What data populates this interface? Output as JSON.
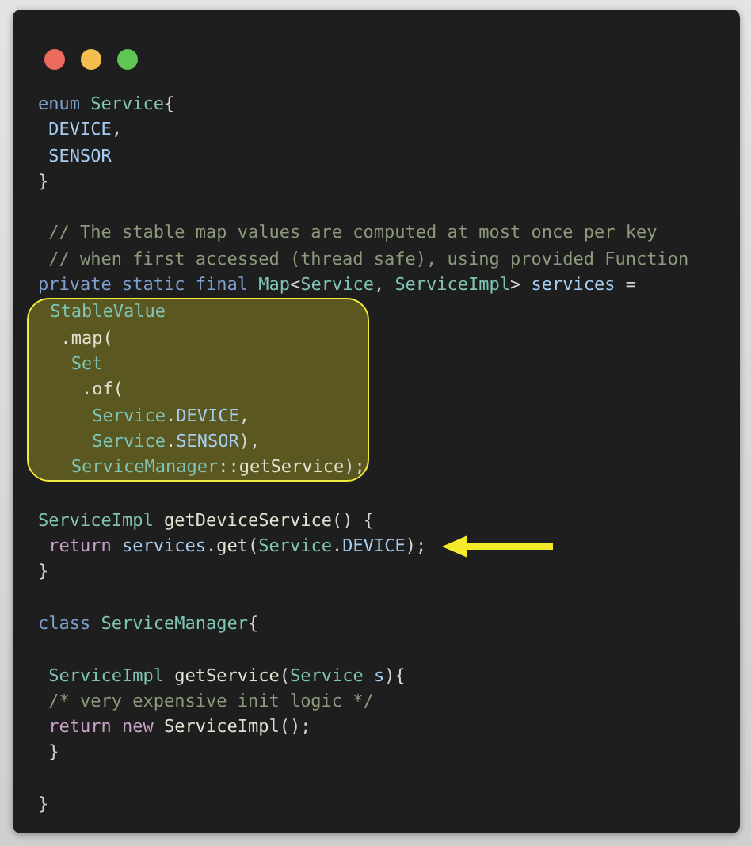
{
  "window": {
    "controls": [
      {
        "color": "#ec6a5e"
      },
      {
        "color": "#f4bf4f"
      },
      {
        "color": "#61c554"
      }
    ]
  },
  "code": {
    "blocks": [
      {
        "kind": "plain",
        "lines": [
          {
            "kind": "code",
            "tokens": [
              {
                "t": "enum ",
                "color": "#7f9fcf"
              },
              {
                "t": "Service",
                "color": "#7fc4b4"
              },
              {
                "t": "{",
                "color": "#d4d4d4"
              }
            ]
          },
          {
            "kind": "code",
            "tokens": [
              {
                "t": " DEVICE",
                "color": "#a6cdf2"
              },
              {
                "t": ",",
                "color": "#d4d4d4"
              }
            ]
          },
          {
            "kind": "code",
            "tokens": [
              {
                "t": " SENSOR",
                "color": "#a6cdf2"
              }
            ]
          },
          {
            "kind": "code",
            "tokens": [
              {
                "t": "}",
                "color": "#d4d4d4"
              }
            ]
          },
          {
            "kind": "blank"
          },
          {
            "kind": "code",
            "tokens": [
              {
                "t": " // The stable map values are computed at most once per key",
                "color": "#8d9a7c"
              }
            ]
          },
          {
            "kind": "code",
            "tokens": [
              {
                "t": " // when first accessed (thread safe), using provided Function",
                "color": "#8d9a7c"
              }
            ]
          },
          {
            "kind": "code",
            "tokens": [
              {
                "t": "private static final ",
                "color": "#7f9fcf"
              },
              {
                "t": "Map",
                "color": "#7fc4b4"
              },
              {
                "t": "<",
                "color": "#d4d4d4"
              },
              {
                "t": "Service",
                "color": "#7fc4b4"
              },
              {
                "t": ", ",
                "color": "#d4d4d4"
              },
              {
                "t": "ServiceImpl",
                "color": "#7fc4b4"
              },
              {
                "t": "> ",
                "color": "#d4d4d4"
              },
              {
                "t": "services",
                "color": "#a6cdf2"
              },
              {
                "t": " =",
                "color": "#d4d4d4"
              }
            ]
          }
        ]
      },
      {
        "kind": "highlight",
        "lines": [
          {
            "kind": "code",
            "tokens": [
              {
                "t": " StableValue",
                "color": "#7fc4b4"
              }
            ]
          },
          {
            "kind": "code",
            "tokens": [
              {
                "t": "  .map(",
                "color": "#e2e2d2"
              }
            ]
          },
          {
            "kind": "code",
            "tokens": [
              {
                "t": "   Set",
                "color": "#7fc4b4"
              }
            ]
          },
          {
            "kind": "code",
            "tokens": [
              {
                "t": "    .of(",
                "color": "#e2e2d2"
              }
            ]
          },
          {
            "kind": "code",
            "tokens": [
              {
                "t": "     Service",
                "color": "#7fc4b4"
              },
              {
                "t": ".",
                "color": "#d4d4d4"
              },
              {
                "t": "DEVICE",
                "color": "#a6cdf2"
              },
              {
                "t": ",",
                "color": "#d4d4d4"
              }
            ]
          },
          {
            "kind": "code",
            "tokens": [
              {
                "t": "     Service",
                "color": "#7fc4b4"
              },
              {
                "t": ".",
                "color": "#d4d4d4"
              },
              {
                "t": "SENSOR",
                "color": "#a6cdf2"
              },
              {
                "t": "),",
                "color": "#d4d4d4"
              }
            ]
          },
          {
            "kind": "code",
            "tokens": [
              {
                "t": "   ServiceManager",
                "color": "#7fc4b4"
              },
              {
                "t": "::",
                "color": "#d4d4d4"
              },
              {
                "t": "getService",
                "color": "#e2e2d2"
              },
              {
                "t": ");",
                "color": "#d4d4d4"
              }
            ]
          }
        ]
      },
      {
        "kind": "plain",
        "lines": [
          {
            "kind": "blank"
          },
          {
            "kind": "code",
            "tokens": [
              {
                "t": "ServiceImpl ",
                "color": "#7fc4b4"
              },
              {
                "t": "getDeviceService",
                "color": "#e2e2d2"
              },
              {
                "t": "() {",
                "color": "#d4d4d4"
              }
            ]
          },
          {
            "kind": "pointed",
            "tokens": [
              {
                "t": " return ",
                "color": "#c6a0c6"
              },
              {
                "t": "services",
                "color": "#a6cdf2"
              },
              {
                "t": ".",
                "color": "#d4d4d4"
              },
              {
                "t": "get",
                "color": "#e2e2d2"
              },
              {
                "t": "(",
                "color": "#d4d4d4"
              },
              {
                "t": "Service",
                "color": "#7fc4b4"
              },
              {
                "t": ".",
                "color": "#d4d4d4"
              },
              {
                "t": "DEVICE",
                "color": "#a6cdf2"
              },
              {
                "t": ");",
                "color": "#d4d4d4"
              }
            ]
          },
          {
            "kind": "code",
            "tokens": [
              {
                "t": "}",
                "color": "#d4d4d4"
              }
            ]
          },
          {
            "kind": "blank"
          },
          {
            "kind": "code",
            "tokens": [
              {
                "t": "class ",
                "color": "#7f9fcf"
              },
              {
                "t": "ServiceManager",
                "color": "#7fc4b4"
              },
              {
                "t": "{",
                "color": "#d4d4d4"
              }
            ]
          },
          {
            "kind": "blank"
          },
          {
            "kind": "code",
            "tokens": [
              {
                "t": " ServiceImpl ",
                "color": "#7fc4b4"
              },
              {
                "t": "getService",
                "color": "#e2e2d2"
              },
              {
                "t": "(",
                "color": "#d4d4d4"
              },
              {
                "t": "Service ",
                "color": "#7fc4b4"
              },
              {
                "t": "s",
                "color": "#a6cdf2"
              },
              {
                "t": "){",
                "color": "#d4d4d4"
              }
            ]
          },
          {
            "kind": "code",
            "tokens": [
              {
                "t": " /* very expensive init logic */",
                "color": "#8d9a7c"
              }
            ]
          },
          {
            "kind": "code",
            "tokens": [
              {
                "t": " return new ",
                "color": "#c6a0c6"
              },
              {
                "t": "ServiceImpl",
                "color": "#e2e2d2"
              },
              {
                "t": "();",
                "color": "#d4d4d4"
              }
            ]
          },
          {
            "kind": "code",
            "tokens": [
              {
                "t": " }",
                "color": "#d4d4d4"
              }
            ]
          },
          {
            "kind": "blank"
          },
          {
            "kind": "code",
            "tokens": [
              {
                "t": "}",
                "color": "#d4d4d4"
              }
            ]
          }
        ]
      }
    ]
  }
}
